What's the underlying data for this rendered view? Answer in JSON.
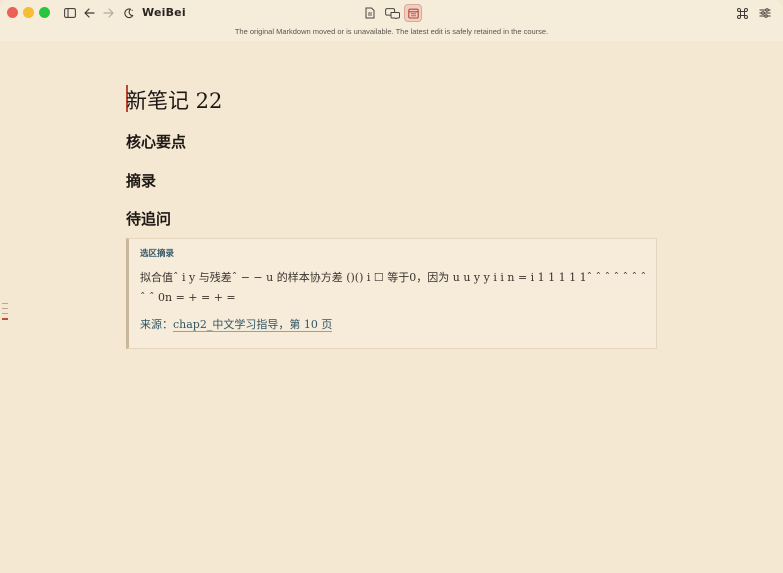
{
  "window": {
    "title": "WeiBei",
    "banner": "The original Markdown moved or is unavailable. The latest edit is safely retained in the course."
  },
  "toolbar": {
    "sidebar_icon": "sidebar-icon",
    "back_icon": "arrow-left-icon",
    "forward_icon": "arrow-right-icon",
    "theme_icon": "moon-icon",
    "view_modes": [
      "document-icon",
      "chat-bubbles-icon",
      "calendar-icon"
    ],
    "active_view": 2,
    "command_icon": "command-icon",
    "settings_icon": "sliders-icon"
  },
  "document": {
    "title": "新笔记 22",
    "sections": [
      "核心要点",
      "摘录",
      "待追问"
    ],
    "quote": {
      "label": "选区摘录",
      "text": "拟合值ˆ i y 与残差ˆ − − u 的样本协方差 ()() i ☐ 等于0，因为 u u y y i i n = i 1 1 1 1 1ˆ ˆ ˆ ˆ ˆ ˆ ˆ ˆ ˆ 0n = + = + =",
      "source_prefix": "来源：",
      "source_link": "chap2_中文学习指导，第 10 页"
    }
  },
  "colors": {
    "background": "#f4e8d3",
    "accent": "#b8482f",
    "link": "#2f5668"
  }
}
